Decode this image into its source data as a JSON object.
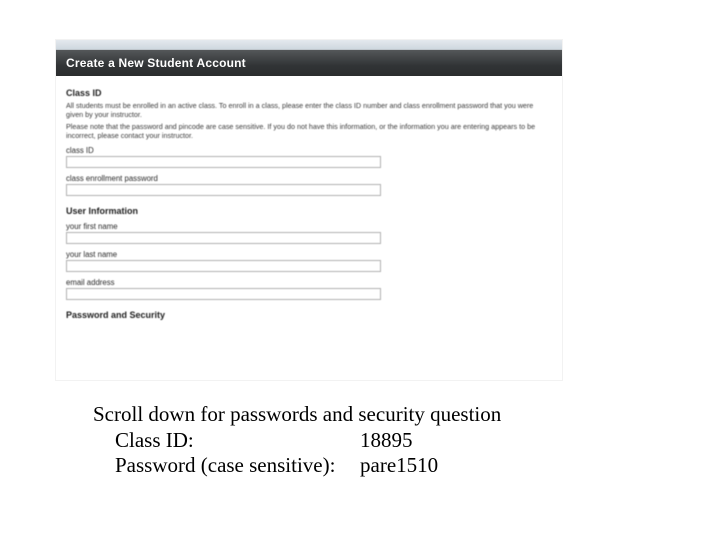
{
  "screenshot": {
    "title": "Create a New Student Account",
    "section_class": "Class ID",
    "para1": "All students must be enrolled in an active class. To enroll in a class, please enter the class ID number and class enrollment password that you were given by your instructor.",
    "para2": "Please note that the password and pincode are case sensitive. If you do not have this information, or the information you are entering appears to be incorrect, please contact your instructor.",
    "label_classid": "class ID",
    "label_enrollpw": "class enrollment password",
    "section_user": "User Information",
    "label_fname": "your first name",
    "label_lname": "your last name",
    "label_email": "email address",
    "section_pw": "Password and Security"
  },
  "caption": {
    "line1": "Scroll down for passwords and security question",
    "class_label": "Class ID:",
    "class_value": "18895",
    "pw_label": "Password (case sensitive):",
    "pw_value": "pare1510"
  }
}
